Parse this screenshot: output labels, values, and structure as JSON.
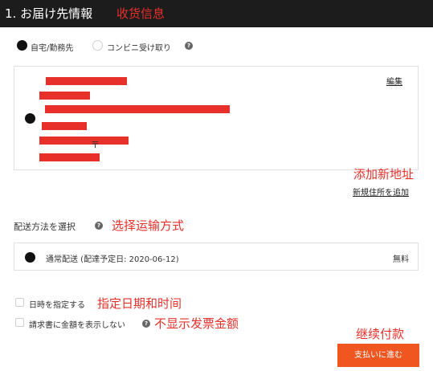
{
  "header": {
    "title": "1. お届け先情報",
    "annotation": "收货信息"
  },
  "delivery_options": {
    "home": "自宅/勤務先",
    "convenience": "コンビニ受け取り",
    "selected": "home"
  },
  "address": {
    "edit_link": "編集",
    "partial_text": "〒"
  },
  "add_address": {
    "annotation": "添加新地址",
    "link": "新規住所を追加"
  },
  "shipping": {
    "label": "配送方法を選択",
    "annotation": "选择运输方式",
    "method": "通常配送 (配達予定日: 2020-06-12)",
    "price": "無料"
  },
  "options": {
    "datetime_label": "日時を指定する",
    "datetime_annotation": "指定日期和时间",
    "invoice_label": "請求書に金額を表示しない",
    "invoice_annotation": "不显示发票金额"
  },
  "checkout": {
    "annotation": "继续付款",
    "button": "支払いに進む"
  },
  "colors": {
    "header_bg": "#1c1c1c",
    "annotation_red": "#e8302a",
    "button_orange": "#f0561f"
  }
}
